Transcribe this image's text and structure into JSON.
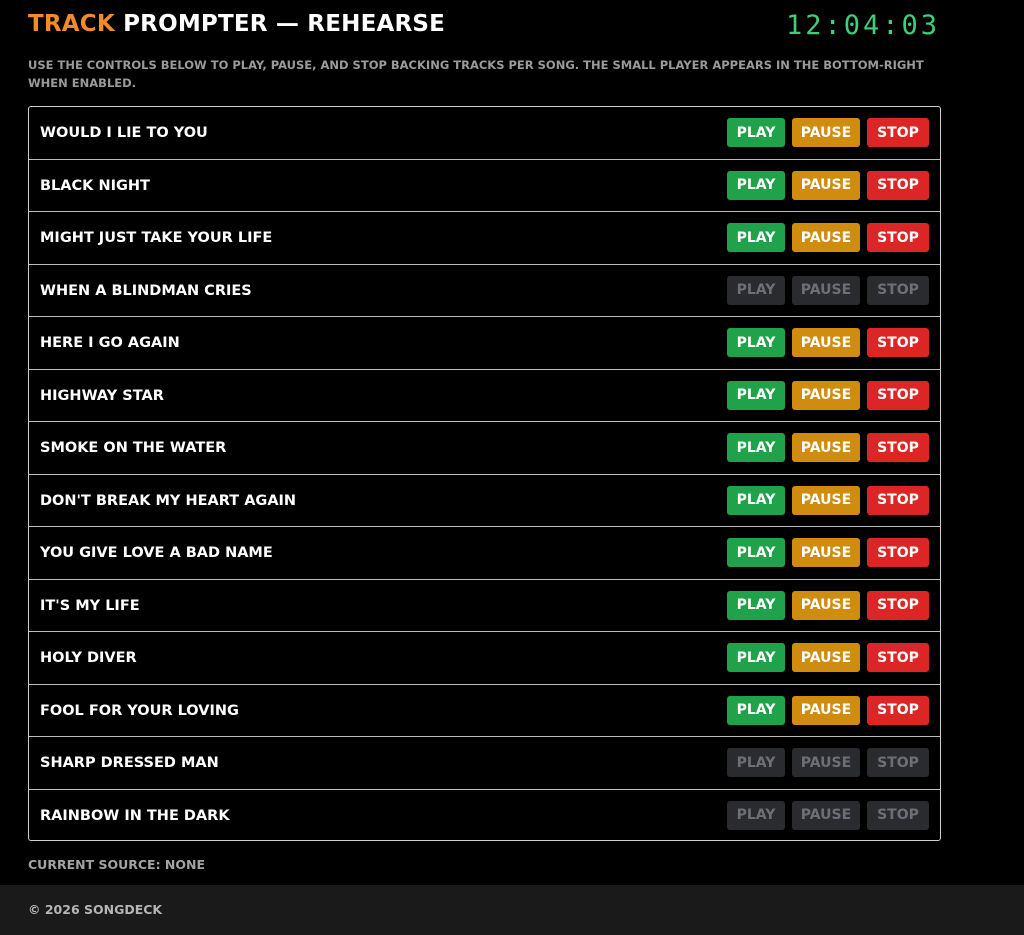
{
  "header": {
    "title_accent": "TRACK",
    "title_rest": " PROMPTER — REHEARSE",
    "clock": "12:04:03"
  },
  "subtitle": "USE THE CONTROLS BELOW TO PLAY, PAUSE, AND STOP BACKING TRACKS PER SONG. THE SMALL PLAYER APPEARS IN THE BOTTOM-RIGHT WHEN ENABLED.",
  "buttons": {
    "play": "PLAY",
    "pause": "PAUSE",
    "stop": "STOP"
  },
  "songs": [
    {
      "title": "WOULD I LIE TO YOU",
      "enabled": true
    },
    {
      "title": "BLACK NIGHT",
      "enabled": true
    },
    {
      "title": "MIGHT JUST TAKE YOUR LIFE",
      "enabled": true
    },
    {
      "title": "WHEN A BLINDMAN CRIES",
      "enabled": false
    },
    {
      "title": "HERE I GO AGAIN",
      "enabled": true
    },
    {
      "title": "HIGHWAY STAR",
      "enabled": true
    },
    {
      "title": "SMOKE ON THE WATER",
      "enabled": true
    },
    {
      "title": "DON'T BREAK MY HEART AGAIN",
      "enabled": true
    },
    {
      "title": "YOU GIVE LOVE A BAD NAME",
      "enabled": true
    },
    {
      "title": "IT'S MY LIFE",
      "enabled": true
    },
    {
      "title": "HOLY DIVER",
      "enabled": true
    },
    {
      "title": "FOOL FOR YOUR LOVING",
      "enabled": true
    },
    {
      "title": "SHARP DRESSED MAN",
      "enabled": false
    },
    {
      "title": "RAINBOW IN THE DARK",
      "enabled": false
    }
  ],
  "status": {
    "current_source": "CURRENT SOURCE: NONE"
  },
  "footer": {
    "copyright": "© 2026 SONGDECK"
  },
  "colors": {
    "accent": "#f08a2b",
    "clock": "#3ecf7a",
    "play": "#1fa24a",
    "pause": "#cf8c0f",
    "stop": "#dc2626",
    "disabled": "#2a2b2f"
  }
}
